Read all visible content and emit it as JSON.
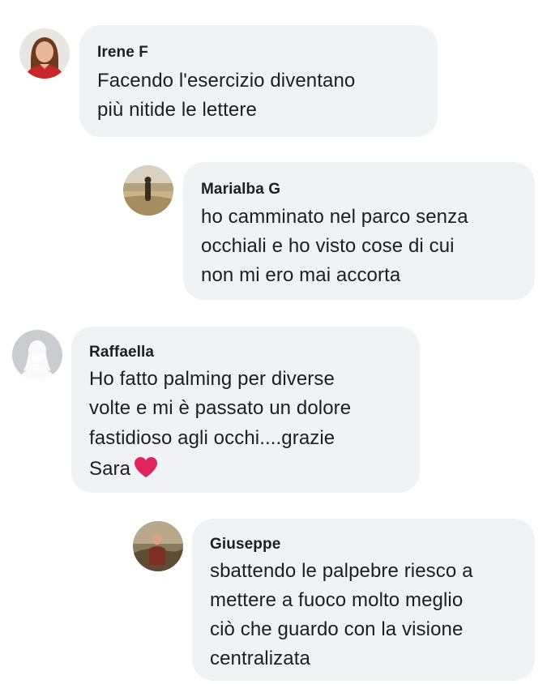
{
  "comments": [
    {
      "author": "Irene F",
      "lines": [
        "Facendo l'esercizio diventano",
        "più nitide le lettere"
      ],
      "avatar_icon": "user-photo-woman-red-shirt"
    },
    {
      "author": "Marialba G",
      "lines": [
        "ho camminato nel parco senza",
        "occhiali e ho visto cose di cui",
        "non mi ero mai accorta"
      ],
      "avatar_icon": "user-photo-beach"
    },
    {
      "author": "Raffaella",
      "lines": [
        "Ho fatto palming per diverse",
        "volte e mi è passato un dolore",
        "fastidioso agli occhi....grazie",
        "Sara"
      ],
      "emoji": "heart-icon",
      "avatar_icon": "default-avatar-silhouette"
    },
    {
      "author": "Giuseppe",
      "lines": [
        "sbattendo le palpebre riesco a",
        "mettere a fuoco molto meglio",
        "ciò che guardo con la visione",
        "centralizata"
      ],
      "avatar_icon": "user-photo-outdoor"
    }
  ],
  "colors": {
    "bubble": "#f0f2f5",
    "text": "#1c1e21",
    "heart": "#e0245e"
  }
}
